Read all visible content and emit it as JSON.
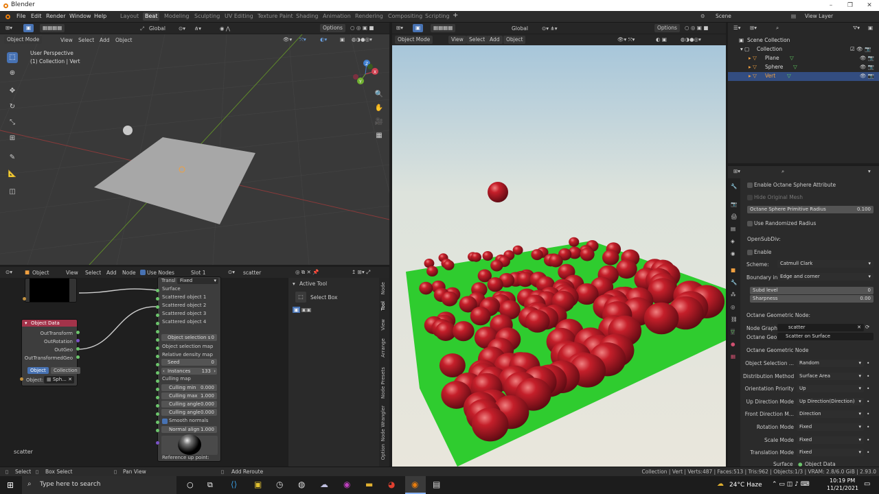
{
  "window": {
    "title": "Blender",
    "minimize": "–",
    "maximize": "❐",
    "close": "✕"
  },
  "menu": {
    "items": [
      "File",
      "Edit",
      "Render",
      "Window",
      "Help"
    ]
  },
  "workspaces": {
    "tabs": [
      "Layout",
      "Beat",
      "Modeling",
      "Sculpting",
      "UV Editing",
      "Texture Paint",
      "Shading",
      "Animation",
      "Rendering",
      "Compositing",
      "Scripting"
    ],
    "active": "Beat",
    "add": "+"
  },
  "topright": {
    "scene": "Scene",
    "view_layer": "View Layer"
  },
  "viewport3d": {
    "orientation": "Global",
    "options": "Options",
    "mode": "Object Mode",
    "menus": [
      "View",
      "Select",
      "Add",
      "Object"
    ],
    "overlay_text_1": "User Perspective",
    "overlay_text_2": "(1) Collection | Vert",
    "axis_x": "X",
    "axis_y": "Y",
    "axis_z": "Z"
  },
  "renderview": {
    "orientation": "Global",
    "options": "Options",
    "mode": "Object Mode",
    "menus": [
      "View",
      "Select",
      "Add",
      "Object"
    ]
  },
  "outliner": {
    "root": "Scene Collection",
    "collection": "Collection",
    "objects": [
      "Plane",
      "Sphere",
      "Vert"
    ],
    "selected": "Vert"
  },
  "properties": {
    "enable_sphere_attr": "Enable Octane Sphere Attribute",
    "hide_original_mesh": "Hide Original Mesh",
    "sphere_radius_label": "Octane Sphere Primitive Radius",
    "sphere_radius_value": "0.100",
    "use_random_radius": "Use Randomized Radius",
    "opensubdiv": "OpenSubDiv:",
    "enable": "Enable",
    "scheme_label": "Scheme:",
    "scheme_value": "Catmull Clark",
    "boundary_label": "Boundary in...",
    "boundary_value": "Edge and corner",
    "subd_level_label": "Subd level",
    "subd_level_value": "0",
    "sharpness_label": "Sharpness",
    "sharpness_value": "0.00",
    "geo_node_header": "Octane Geometric Node:",
    "node_graph_label": "Node Graph:",
    "node_graph_value": "scatter",
    "octane_geo_label": "Octane Geo...",
    "octane_geo_value": "Scatter on Surface",
    "geo_node_section": "Octane Geometric Node",
    "rows": [
      {
        "label": "Object Selection ...",
        "value": "Random"
      },
      {
        "label": "Distribution Method",
        "value": "Surface Area"
      },
      {
        "label": "Orientation Priority",
        "value": "Up"
      },
      {
        "label": "Up Direction Mode",
        "value": "Up Direction(Direction)"
      },
      {
        "label": "Front Direction M...",
        "value": "Direction"
      },
      {
        "label": "Rotation Mode",
        "value": "Fixed"
      },
      {
        "label": "Scale Mode",
        "value": "Fixed"
      },
      {
        "label": "Translation Mode",
        "value": "Fixed"
      }
    ],
    "surface_label": "Surface",
    "surface_value": "Object Data"
  },
  "nodeeditor": {
    "type": "Object",
    "menus": [
      "View",
      "Select",
      "Add",
      "Node"
    ],
    "use_nodes": "Use Nodes",
    "slot": "Slot 1",
    "tree_name": "scatter",
    "node_label": "scatter",
    "objdata_node": {
      "title": "Object Data",
      "outputs": [
        "OutTransform",
        "OutRotation",
        "OutGeo",
        "OutTransformedGeo"
      ],
      "tab_object": "Object",
      "tab_collection": "Collection",
      "object_label": "Object:",
      "object_value": "Sph..."
    },
    "scatter_node": {
      "transl_label": "Transl",
      "transl_value": "Fixed",
      "inputs": [
        "Surface",
        "Scattered object 1",
        "Scattered object 2",
        "Scattered object 3",
        "Scattered object 4"
      ],
      "obj_sel_label": "Object selection s",
      "obj_sel_value": "0",
      "obj_sel_map": "Object selection map",
      "density_map": "Relative density map",
      "seed_label": "Seed",
      "seed_value": "0",
      "instances_label": "Instances",
      "instances_value": "133",
      "culling_map": "Culling map",
      "cull_min_label": "Culling min",
      "cull_min_value": "0.000",
      "cull_max_label": "Culling max",
      "cull_max_value": "1.000",
      "cull_ang1_label": "Culling angle",
      "cull_ang1_value": "0.000",
      "cull_ang2_label": "Culling angle",
      "cull_ang2_value": "0.000",
      "smooth_normals": "Smooth normals",
      "normal_align_label": "Normal align",
      "normal_align_value": "1.000",
      "ref_up": "Reference up point:"
    },
    "npanel": {
      "title": "Active Tool",
      "tool": "Select Box"
    },
    "side_tabs": [
      "Node",
      "Tool",
      "View",
      "Arrange",
      "Node Presets",
      "Node Wrangler",
      "Option"
    ]
  },
  "status": {
    "select": "Select",
    "box_select": "Box Select",
    "pan": "Pan View",
    "reroute": "Add Reroute",
    "info": "Collection | Vert | Verts:487 | Faces:513 | Tris:962 | Objects:1/3 | VRAM: 2.8/6.0 GiB | 2.93.0"
  },
  "taskbar": {
    "search_placeholder": "Type here to search",
    "weather": "24°C  Haze",
    "time": "10:19 PM",
    "date": "11/21/2021"
  },
  "colors": {
    "accent": "#4772b3",
    "selected_row": "#334d80",
    "node_header_red": "#a3334a",
    "socket_green": "#6cc56c"
  }
}
